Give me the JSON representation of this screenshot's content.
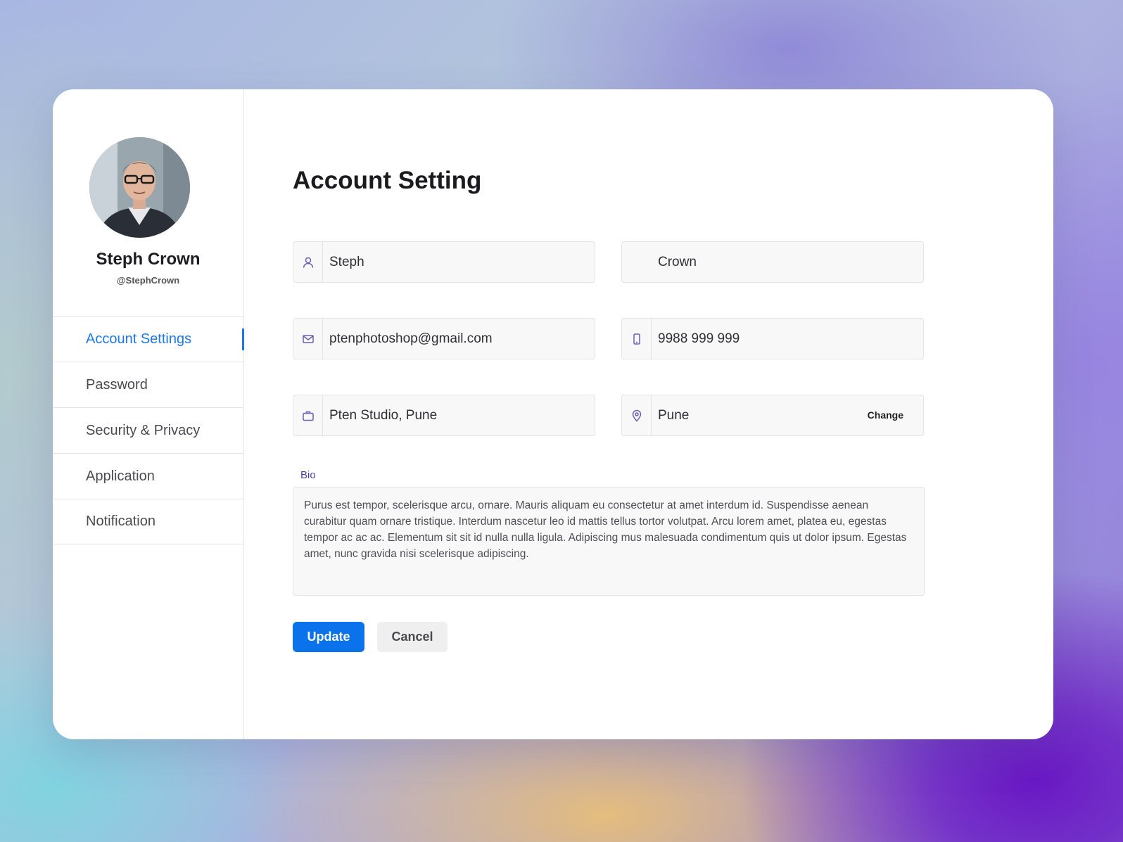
{
  "profile": {
    "name": "Steph Crown",
    "handle": "@StephCrown"
  },
  "sidebar": {
    "items": [
      {
        "label": "Account Settings",
        "active": true
      },
      {
        "label": "Password"
      },
      {
        "label": "Security & Privacy"
      },
      {
        "label": "Application"
      },
      {
        "label": "Notification"
      }
    ]
  },
  "main": {
    "title": "Account Setting",
    "fields": {
      "first_name": {
        "value": "Steph",
        "icon": "user-icon"
      },
      "last_name": {
        "value": "Crown"
      },
      "email": {
        "value": "ptenphotoshop@gmail.com",
        "icon": "mail-icon"
      },
      "phone": {
        "value": "9988 999 999",
        "icon": "phone-icon"
      },
      "company": {
        "value": "Pten Studio, Pune",
        "icon": "briefcase-icon"
      },
      "location": {
        "value": "Pune",
        "icon": "location-pin-icon",
        "action_label": "Change"
      }
    },
    "bio": {
      "label": "Bio",
      "text": "Purus est tempor, scelerisque arcu, ornare. Mauris aliquam eu consectetur at amet interdum id. Suspendisse aenean curabitur quam ornare tristique. Interdum nascetur leo id mattis tellus tortor volutpat. Arcu lorem amet, platea eu, egestas tempor ac ac ac. Elementum sit sit id nulla nulla ligula. Adipiscing mus malesuada condimentum quis ut dolor ipsum. Egestas amet, nunc gravida nisi scelerisque adipiscing."
    },
    "buttons": {
      "update_label": "Update",
      "cancel_label": "Cancel"
    }
  },
  "colors": {
    "accent": "#0a72ea",
    "active_nav": "#1e78e8",
    "bio_label": "#4a3fa0",
    "icon": "#6a5fb0"
  }
}
